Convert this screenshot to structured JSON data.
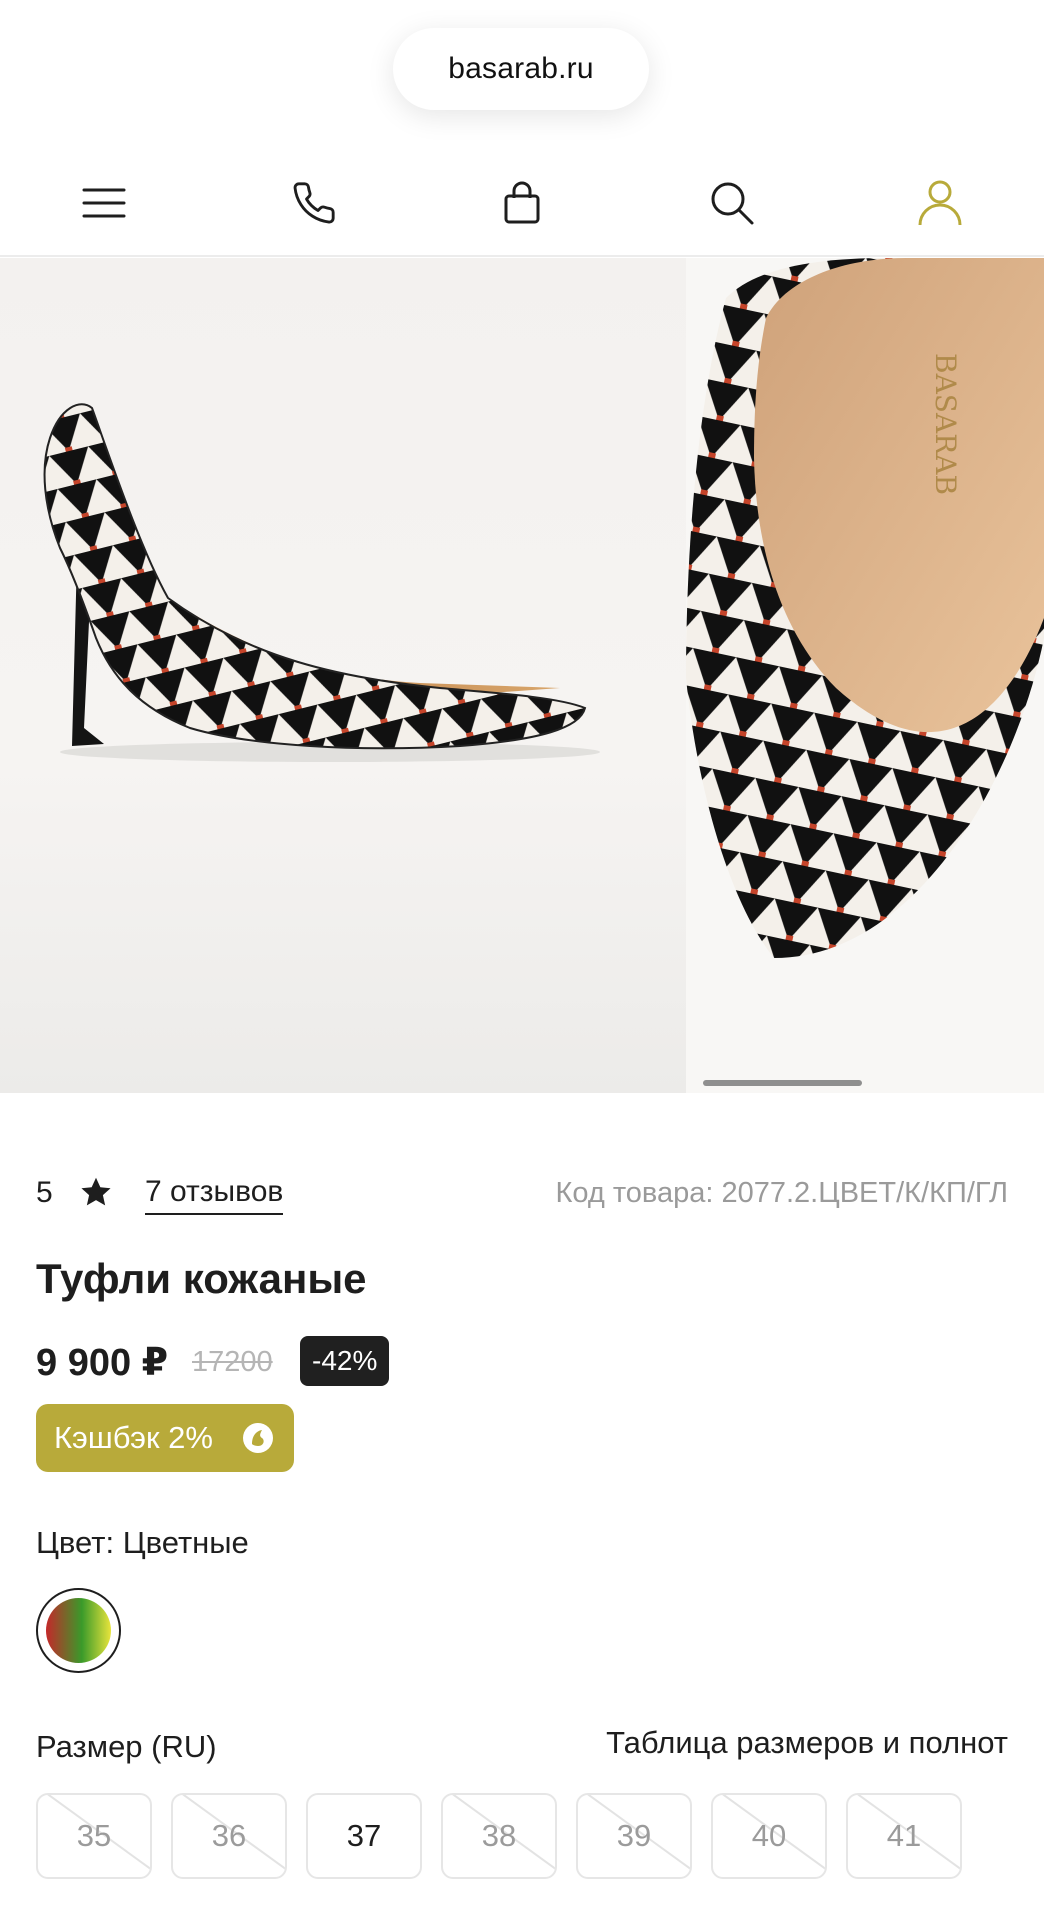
{
  "browser": {
    "url": "basarab.ru"
  },
  "nav": {
    "icons": [
      "menu-icon",
      "phone-icon",
      "bag-icon",
      "search-icon",
      "user-icon"
    ],
    "accent": "#b8aa3a"
  },
  "gallery": {
    "slides": 2,
    "active_index": 0
  },
  "product": {
    "rating": "5",
    "reviews_label": "7 отзывов",
    "sku": "Код товара: 2077.2.ЦВЕТ/К/КП/ГЛ",
    "title": "Туфли кожаные",
    "price": "9 900 ₽",
    "old_price": "17200",
    "discount": "-42%",
    "cashback": "Кэшбэк 2%",
    "color_label": "Цвет: Цветные",
    "size_label": "Размер (RU)",
    "size_table_link": "Таблица размеров и полнот",
    "sizes": [
      {
        "value": "35",
        "available": false
      },
      {
        "value": "36",
        "available": false
      },
      {
        "value": "37",
        "available": true
      },
      {
        "value": "38",
        "available": false
      },
      {
        "value": "39",
        "available": false
      },
      {
        "value": "40",
        "available": false
      },
      {
        "value": "41",
        "available": false
      }
    ]
  },
  "colors": {
    "cashback_bg": "#b8aa3a",
    "discount_bg": "#202020",
    "sku_text": "#9a9a9a"
  }
}
